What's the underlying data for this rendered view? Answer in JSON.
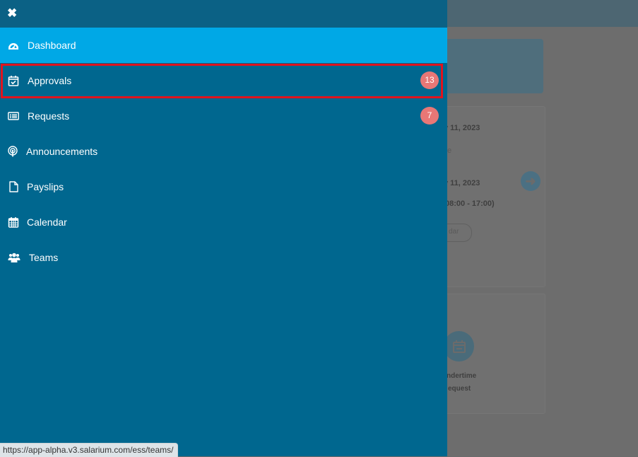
{
  "drawer": {
    "close_icon": "close-icon",
    "items": [
      {
        "key": "dashboard",
        "label": "Dashboard",
        "icon": "dashboard-icon",
        "active": true
      },
      {
        "key": "approvals",
        "label": "Approvals",
        "icon": "calendar-check-icon",
        "badge": "13",
        "highlighted": true
      },
      {
        "key": "requests",
        "label": "Requests",
        "icon": "list-icon",
        "badge": "7"
      },
      {
        "key": "announcements",
        "label": "Announcements",
        "icon": "broadcast-icon"
      },
      {
        "key": "payslips",
        "label": "Payslips",
        "icon": "document-icon"
      },
      {
        "key": "calendar",
        "label": "Calendar",
        "icon": "calendar-icon"
      },
      {
        "key": "teams",
        "label": "Teams",
        "icon": "users-icon"
      }
    ]
  },
  "background": {
    "date_1": "y 11, 2023",
    "sub_1": "e",
    "date_2": "y 11, 2023",
    "shift": "08:00 - 17:00)",
    "pill": "dar",
    "card2_line1": "ndertime",
    "card2_line2": "equest"
  },
  "status_url": "https://app-alpha.v3.salarium.com/ess/teams/",
  "colors": {
    "drawer_bg": "#00678f",
    "active_bg": "#00a8e6",
    "badge_bg": "#e87776",
    "highlight_border": "#e0141e"
  }
}
